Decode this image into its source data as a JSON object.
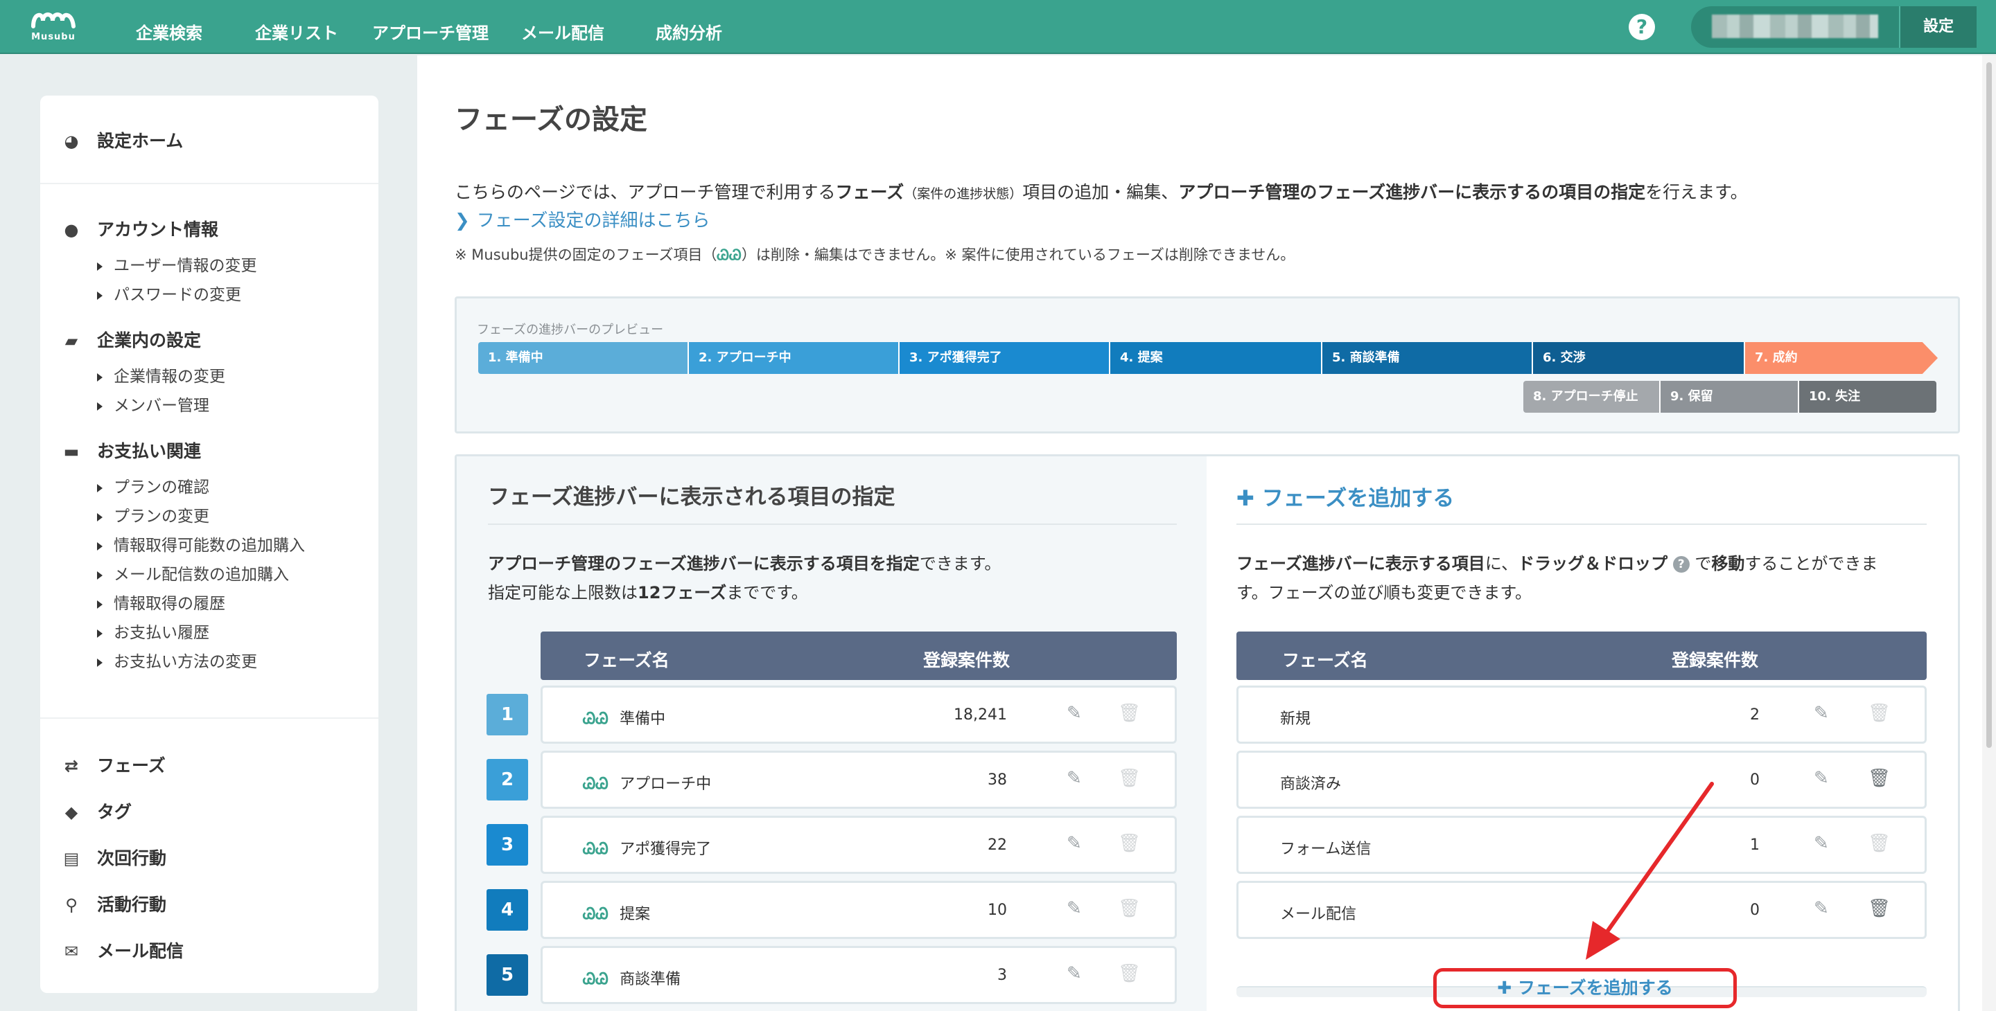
{
  "brand": {
    "name": "Musubu",
    "accent": "#3aa38e"
  },
  "nav": {
    "items": [
      "企業検索",
      "企業リスト",
      "アプローチ管理",
      "メール配信",
      "成約分析"
    ],
    "help": "?",
    "settings": "設定"
  },
  "sidebar": {
    "home": "設定ホーム",
    "account": {
      "title": "アカウント情報",
      "items": [
        "ユーザー情報の変更",
        "パスワードの変更"
      ]
    },
    "company": {
      "title": "企業内の設定",
      "items": [
        "企業情報の変更",
        "メンバー管理"
      ]
    },
    "payment": {
      "title": "お支払い関連",
      "items": [
        "プランの確認",
        "プランの変更",
        "情報取得可能数の追加購入",
        "メール配信数の追加購入",
        "情報取得の履歴",
        "お支払い履歴",
        "お支払い方法の変更"
      ]
    },
    "bottom": [
      "フェーズ",
      "タグ",
      "次回行動",
      "活動行動",
      "メール配信"
    ]
  },
  "main": {
    "title": "フェーズの設定",
    "desc": {
      "p1": "こちらのページでは、アプローチ管理で利用する",
      "b1": "フェーズ",
      "small": "（案件の進捗状態）",
      "p2": "項目の追加・編集、",
      "b2": "アプローチ管理のフェーズ進捗バーに表示するの項目の指定",
      "p3": "を行えます。"
    },
    "detail_link": "フェーズ設定の詳細はこちら",
    "note_a": "※ Musubu提供の固定のフェーズ項目（",
    "note_mark": "ᏊᏊ",
    "note_b": "）は削除・編集はできません。※ 案件に使用されているフェーズは削除できません。"
  },
  "preview": {
    "label": "フェーズの進捗バーのプレビュー",
    "row1": [
      {
        "label": "1. 準備中",
        "color": "#5badd9"
      },
      {
        "label": "2. アプローチ中",
        "color": "#3a9fd8"
      },
      {
        "label": "3. アポ獲得完了",
        "color": "#1a8ad0"
      },
      {
        "label": "4. 提案",
        "color": "#117cbd"
      },
      {
        "label": "5. 商談準備",
        "color": "#0f6ba5"
      },
      {
        "label": "6. 交渉",
        "color": "#0e5e92"
      },
      {
        "label": "7. 成約",
        "color": "#fb8e6a"
      }
    ],
    "row2": [
      {
        "label": "8. アプローチ停止",
        "color": "#a4a8ac"
      },
      {
        "label": "9. 保留",
        "color": "#8e9398"
      },
      {
        "label": "10. 失注",
        "color": "#6c7276"
      }
    ]
  },
  "left_panel": {
    "title": "フェーズ進捗バーに表示される項目の指定",
    "text1_b": "アプローチ管理のフェーズ進捗バーに表示する項目を指定",
    "text1": "できます。",
    "text2": "指定可能な上限数は",
    "text2_b": "12フェーズ",
    "text2_c": "までです。",
    "col_name": "フェーズ名",
    "col_count": "登録案件数",
    "rows": [
      {
        "num": "1",
        "name": "準備中",
        "count": "18,241",
        "color": "#5badd9"
      },
      {
        "num": "2",
        "name": "アプローチ中",
        "count": "38",
        "color": "#3a9fd8"
      },
      {
        "num": "3",
        "name": "アポ獲得完了",
        "count": "22",
        "color": "#1a8ad0"
      },
      {
        "num": "4",
        "name": "提案",
        "count": "10",
        "color": "#117cbd"
      },
      {
        "num": "5",
        "name": "商談準備",
        "count": "3",
        "color": "#0f6ba5"
      }
    ]
  },
  "right_panel": {
    "title": "フェーズを追加する",
    "t1": "フェーズ進捗バーに表示する項目",
    "t2": "に、",
    "t3": "ドラッグ＆ドロップ",
    "t4": "で",
    "t5": "移動",
    "t6": "することができま",
    "t7": "す。フェーズの並び順も変更できます。",
    "col_name": "フェーズ名",
    "col_count": "登録案件数",
    "rows": [
      {
        "name": "新規",
        "count": "2",
        "deletable": false
      },
      {
        "name": "商談済み",
        "count": "0",
        "deletable": true
      },
      {
        "name": "フォーム送信",
        "count": "1",
        "deletable": false
      },
      {
        "name": "メール配信",
        "count": "0",
        "deletable": true
      }
    ],
    "add_button": "フェーズを追加する"
  }
}
